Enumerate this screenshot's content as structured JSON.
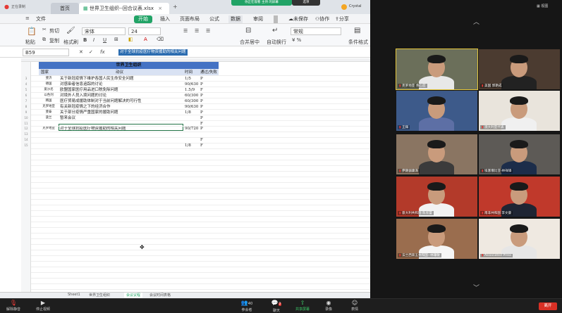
{
  "meeting": {
    "recording": "正在录制",
    "share_status": "你正在观看 主持 的屏幕",
    "share_menu": "选项",
    "view_label": "视图",
    "user_tag": "Crystal"
  },
  "wps": {
    "tabs": [
      {
        "label": "首页"
      },
      {
        "label": "世界卫生组织--回合议表.xlsx"
      }
    ],
    "ribbon_tabs": [
      "文件",
      "开始",
      "插入",
      "页面布局",
      "公式",
      "数据",
      "审阅",
      "视图"
    ],
    "ribbon_right": [
      "未保存",
      "协作",
      "分享"
    ],
    "toolbar": {
      "paste": "粘贴",
      "cut": "剪切",
      "copy": "复制",
      "format_painter": "格式刷",
      "font": "宋体",
      "size": "24",
      "bold": "B",
      "italic": "I",
      "underline": "U",
      "merge": "合并居中",
      "wrap": "自动换行",
      "number_format": "常规",
      "cond_format": "条件格式"
    },
    "name_box": "B59",
    "formula": "对于全球抗疫医疗物资援助的相关问题",
    "sheet_title": "世界卫生组织",
    "headers": {
      "country": "国家",
      "topic": "动议",
      "time": "时间",
      "pass": "通过/失败"
    },
    "rows": [
      {
        "row": "3",
        "country": "斐济",
        "topic": "关于新冠疫情下维护各国人民生命安全问题",
        "time": "1/5",
        "pass": "P"
      },
      {
        "row": "4",
        "country": "德国",
        "topic": "对感染者信息追踪的讨论",
        "time": "90/630",
        "pass": "P"
      },
      {
        "row": "5",
        "country": "爱沙尼",
        "topic": "欧盟国家医疗用品进口税免除问题",
        "time": "1.5/9",
        "pass": "F"
      },
      {
        "row": "6",
        "country": "以色列",
        "topic": "对境外人员入境问题的讨论",
        "time": "60/300",
        "pass": "P"
      },
      {
        "row": "7",
        "country": "韩国",
        "topic": "医疗贸易成援助体制对于当前问题解决的可行性",
        "time": "60/300",
        "pass": "P"
      },
      {
        "row": "8",
        "country": "克罗地亚",
        "topic": "有关新冠疫情之下的经济合作",
        "time": "90/630",
        "pass": "P"
      },
      {
        "row": "9",
        "country": "斐泰",
        "topic": "关于部分疫情严重国家的援助问题",
        "time": "1/8",
        "pass": "P"
      },
      {
        "row": "10",
        "country": "菠兰",
        "topic": "暂来会议",
        "time": "",
        "pass": "P"
      },
      {
        "row": "11",
        "country": "",
        "topic": "",
        "time": "",
        "pass": "F"
      },
      {
        "row": "12",
        "country": "克罗地亚",
        "topic": "对于全球抗疫医疗物资援助的相关问题",
        "time": "90/720",
        "pass": "P"
      },
      {
        "row": "13",
        "country": "",
        "topic": "",
        "time": "",
        "pass": ""
      },
      {
        "row": "14",
        "country": "",
        "topic": "",
        "time": "",
        "pass": "F"
      },
      {
        "row": "15",
        "country": "",
        "topic": "",
        "time": "1/8",
        "pass": "F"
      }
    ],
    "sheet_tabs": [
      "Sheet1",
      "世界卫生组织",
      "会议议程",
      "会议时间表格"
    ]
  },
  "participants": [
    {
      "name": "克罗地亚 余心蕊"
    },
    {
      "name": "美国 郭艳成"
    },
    {
      "name": "王辉"
    },
    {
      "name": "澳大利亚代表"
    },
    {
      "name": "伊朗伽康泽"
    },
    {
      "name": "埃塞俄比亚-林祥锋"
    },
    {
      "name": "意大利共和国 陈欣蕾"
    },
    {
      "name": "南非共和国 李文豪"
    },
    {
      "name": "法兰西第五共和国--林珊敏"
    },
    {
      "name": "Associated Press"
    }
  ],
  "controls": {
    "mute": "解除静音",
    "video": "停止视频",
    "participants": "参会者",
    "participants_count": "40",
    "chat": "聊天",
    "chat_badge": "2",
    "share": "共享屏幕",
    "record": "录像",
    "reactions": "表情",
    "leave": "离开"
  },
  "colors": {
    "title_bar": "#4472c4",
    "selection": "#217346",
    "open_btn": "#21a366",
    "leave": "#d93025"
  }
}
